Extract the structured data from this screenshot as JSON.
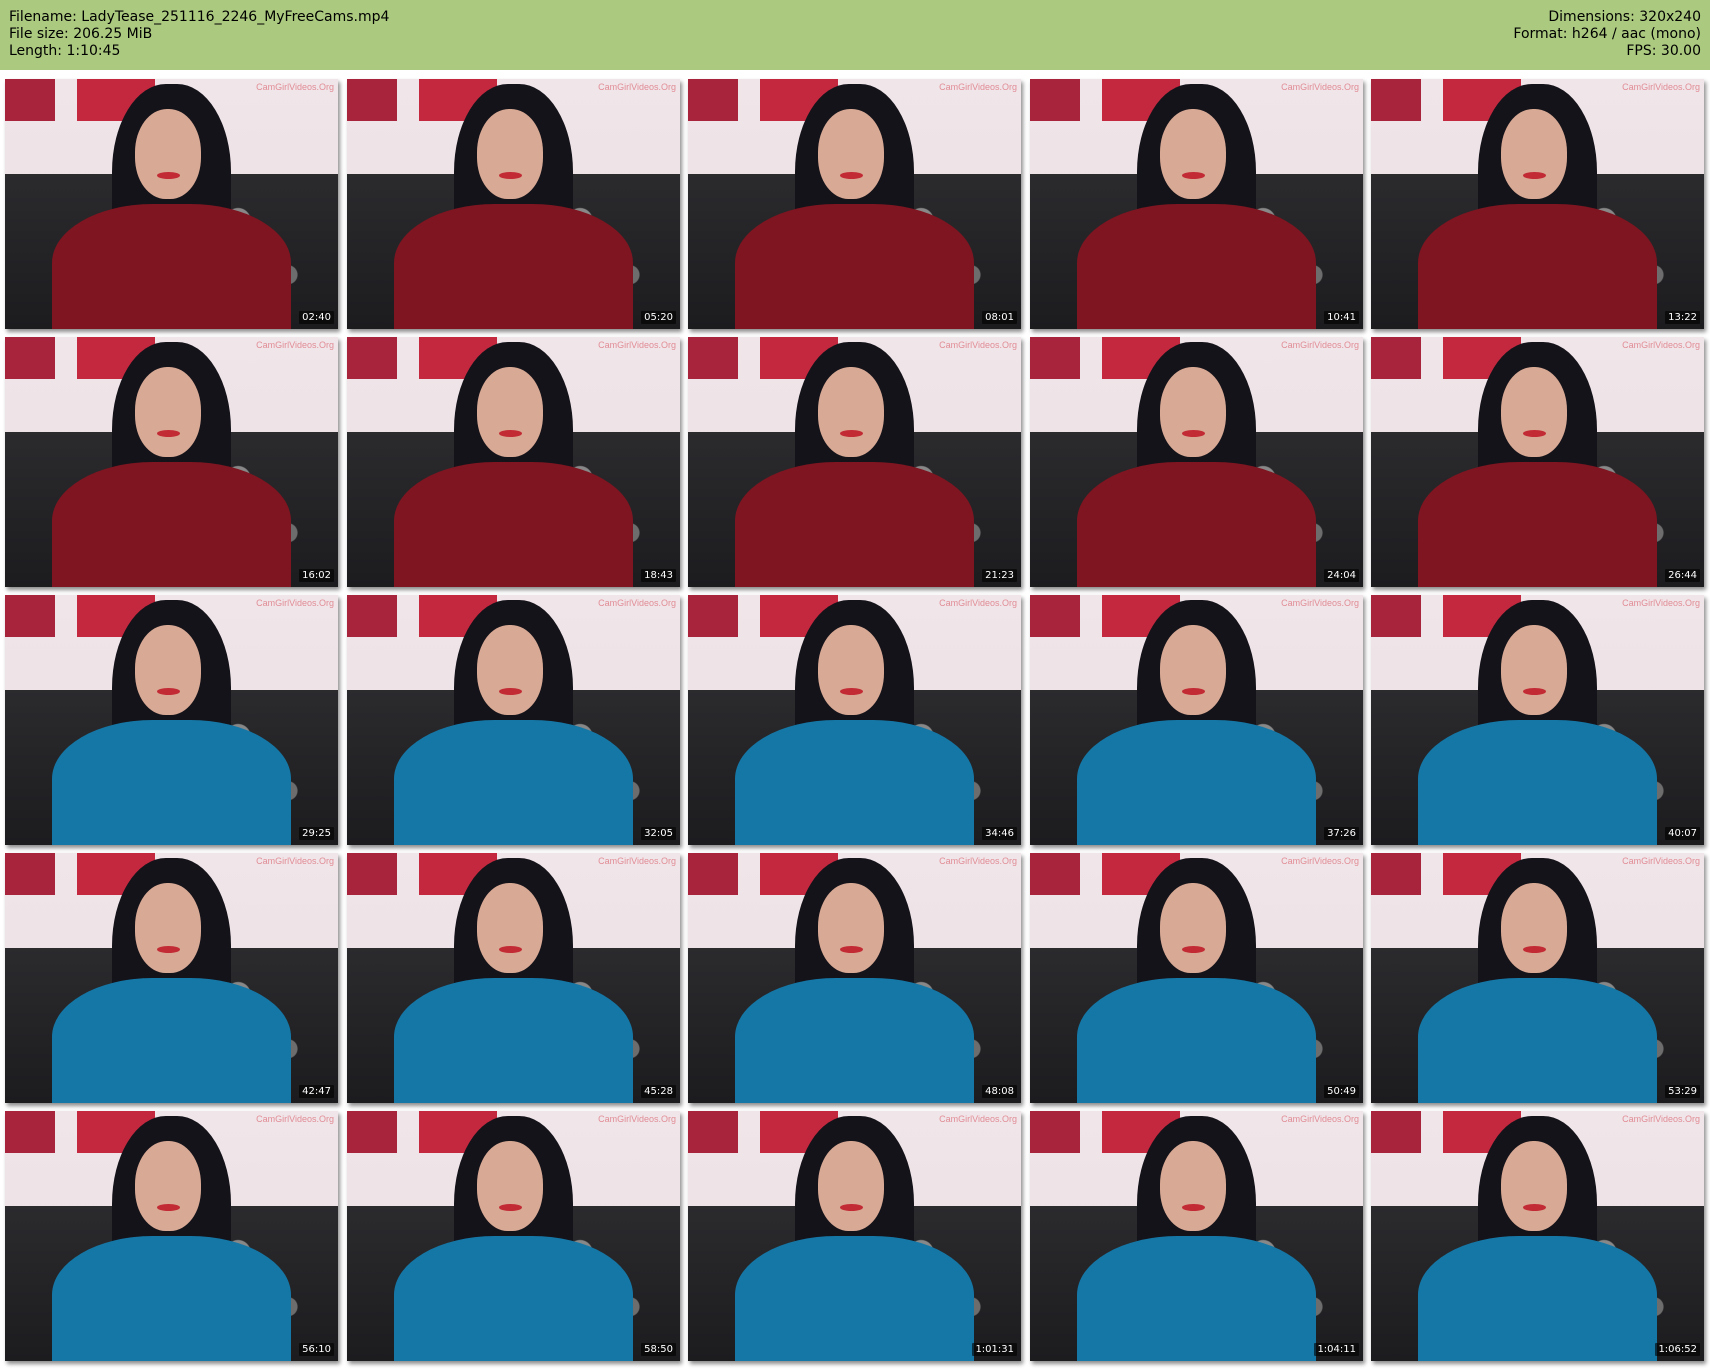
{
  "header": {
    "filename": "Filename: LadyTease_251116_2246_MyFreeCams.mp4",
    "filesize": "File size: 206.25 MiB",
    "length": "Length: 1:10:45",
    "dimensions": "Dimensions: 320x240",
    "format": "Format: h264 / aac (mono)",
    "fps": "FPS: 30.00"
  },
  "colors": {
    "header_bg": "#abca7f",
    "sweater_red": "#7e1520",
    "robe_teal": "#1577a6"
  },
  "watermark": "CamGirlVideos.Org",
  "thumbnails": [
    {
      "timestamp": "02:40",
      "outfit": "red"
    },
    {
      "timestamp": "05:20",
      "outfit": "red"
    },
    {
      "timestamp": "08:01",
      "outfit": "red"
    },
    {
      "timestamp": "10:41",
      "outfit": "red"
    },
    {
      "timestamp": "13:22",
      "outfit": "red"
    },
    {
      "timestamp": "16:02",
      "outfit": "red"
    },
    {
      "timestamp": "18:43",
      "outfit": "red"
    },
    {
      "timestamp": "21:23",
      "outfit": "red"
    },
    {
      "timestamp": "24:04",
      "outfit": "red"
    },
    {
      "timestamp": "26:44",
      "outfit": "red"
    },
    {
      "timestamp": "29:25",
      "outfit": "teal"
    },
    {
      "timestamp": "32:05",
      "outfit": "teal"
    },
    {
      "timestamp": "34:46",
      "outfit": "teal"
    },
    {
      "timestamp": "37:26",
      "outfit": "teal"
    },
    {
      "timestamp": "40:07",
      "outfit": "teal"
    },
    {
      "timestamp": "42:47",
      "outfit": "teal"
    },
    {
      "timestamp": "45:28",
      "outfit": "teal"
    },
    {
      "timestamp": "48:08",
      "outfit": "teal"
    },
    {
      "timestamp": "50:49",
      "outfit": "teal"
    },
    {
      "timestamp": "53:29",
      "outfit": "teal"
    },
    {
      "timestamp": "56:10",
      "outfit": "teal"
    },
    {
      "timestamp": "58:50",
      "outfit": "teal"
    },
    {
      "timestamp": "1:01:31",
      "outfit": "teal"
    },
    {
      "timestamp": "1:04:11",
      "outfit": "teal"
    },
    {
      "timestamp": "1:06:52",
      "outfit": "teal"
    }
  ]
}
